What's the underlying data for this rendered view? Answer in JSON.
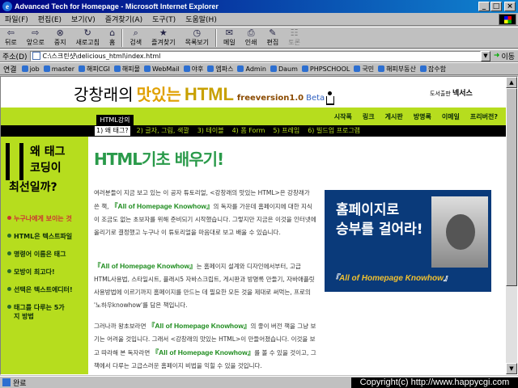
{
  "window": {
    "title": "Advanced Tech for Homepage - Microsoft Internet Explorer",
    "app_icon_glyph": "e",
    "controls": {
      "minimize": "_",
      "maximize": "□",
      "close": "×"
    }
  },
  "menu": [
    "파일(F)",
    "편집(E)",
    "보기(V)",
    "즐겨찾기(A)",
    "도구(T)",
    "도움말(H)"
  ],
  "toolbar": [
    {
      "label": "뒤로",
      "icon": "back-icon",
      "glyph": "⇦",
      "enabled": true
    },
    {
      "label": "앞으로",
      "icon": "forward-icon",
      "glyph": "⇨",
      "enabled": true
    },
    {
      "label": "중지",
      "icon": "stop-icon",
      "glyph": "⊗",
      "enabled": true
    },
    {
      "label": "새로고침",
      "icon": "refresh-icon",
      "glyph": "↻",
      "enabled": true
    },
    {
      "label": "홈",
      "icon": "home-icon",
      "glyph": "⌂",
      "enabled": true
    },
    {
      "label": "검색",
      "icon": "search-icon",
      "glyph": "⌕",
      "enabled": true
    },
    {
      "label": "즐겨찾기",
      "icon": "favorites-icon",
      "glyph": "★",
      "enabled": true
    },
    {
      "label": "목록보기",
      "icon": "history-icon",
      "glyph": "◷",
      "enabled": true
    },
    {
      "label": "메일",
      "icon": "mail-icon",
      "glyph": "✉",
      "enabled": true
    },
    {
      "label": "인쇄",
      "icon": "print-icon",
      "glyph": "⎙",
      "enabled": true
    },
    {
      "label": "편집",
      "icon": "edit-icon",
      "glyph": "✎",
      "enabled": true
    },
    {
      "label": "토론",
      "icon": "discuss-icon",
      "glyph": "☷",
      "enabled": false
    }
  ],
  "address": {
    "label": "주소(D)",
    "value": "C:\\스크린샷\\delicious_html\\index.html",
    "go_label": "이동",
    "go_glyph": "➜",
    "dropdown_glyph": "▼"
  },
  "links": {
    "label": "연결",
    "items": [
      "job",
      "master",
      "해피CGI",
      "해피몰",
      "WebMail",
      "야후",
      "엠파스",
      "Admin",
      "Daum",
      "PHPSCHOOL",
      "국민",
      "해피부동산",
      "잡수함"
    ]
  },
  "page": {
    "title_parts": [
      "강창래의",
      "맛있는",
      "HTML",
      "freeversion1.0",
      "Beta"
    ],
    "publisher_small": "도서출판",
    "publisher_name": "넥서스",
    "nav": [
      "시작폭",
      "링크",
      "게시판",
      "방명록",
      "이메일",
      "프리버전?"
    ],
    "tab_label": "HTML강의",
    "tabs": [
      "1) 왜 태그?",
      "2) 글자, 그림, 색깔",
      "3) 테이블",
      "4) 폼 Form",
      "5) 프레임",
      "6) 빌드업 프로그램"
    ],
    "sidebar_head": [
      "왜 태그",
      "코딩이",
      "최선일까?"
    ],
    "sidebar_items": [
      {
        "label": "누구나에게 보이는 것",
        "highlight": true
      },
      {
        "label": "HTML은 텍스트파일",
        "highlight": false
      },
      {
        "label": "명령어 이름은 태그",
        "highlight": false
      },
      {
        "label": "모방이 최고다!",
        "highlight": false
      },
      {
        "label": "선택은 텍스트에디터!",
        "highlight": false
      },
      {
        "label": "태그를 다루는 5가지 방법",
        "highlight": false
      }
    ],
    "main_title": "HTML기초 배우기!",
    "para1_a": "여러분들이 지금 보고 있는 이 공자 튜토리얼, <강창래의 맛있는 HTML>은 강창래가 쓴 책, ",
    "para1_hl": "『All of Homepage Knowhow』",
    "para1_b": "의 독자를 가운데 홈페이지에 대한 지식이 조금도 없는 초보자를 위해 준비되기 시작했습니다. 그렇지만 지금은 이것을 인터넷에 올리기로 결정했고 누구나 이 튜토리얼을 마음대로 보고 배울 수 있습니다.",
    "para2_hl": "『All of Homepage Knowhow』",
    "para2_b": "는 홈페이지 설계와 디자인에서부터, 고급 HTML사용법, 스타일시트, 플래시5 자바스크립트, 게시판과 방명록 만들기, 자바애플릿 사용방법에 이르기까지 홈페이지를 만드는 데 필요한 모든 것을 제대로 써먹는, 프로의 '노하우knowhow'를 담은 책입니다.",
    "para3_a": "그러나까 왕초보라면 ",
    "para3_hl1": "『All of Homepage Knowhow』",
    "para3_b": "의 좋이 버전 책을 그냥 보기는 어려울 것입니다. 그래서 <강창래의 맛있는 HTML>이 만들어졌습니다. 이것을 보고 따라해 본 독자라면 ",
    "para3_hl2": "『All of Homepage Knowhow』",
    "para3_c": "를 볼 수 있을 것이고, 그 책에서 다루는 고급스러운 홈페이지 비법을 익힐 수 있을 것입니다.",
    "book_ad": {
      "line1": "홈페이지로",
      "line2": "승부를 걸어라!",
      "line3_prefix": "『",
      "line3": "All of Homepage Knowhow",
      "line3_suffix": "』"
    }
  },
  "scrollbar": {
    "up_glyph": "▲",
    "down_glyph": "▼"
  },
  "status": {
    "text": "완료"
  },
  "copyright": "Copyright(c) http://www.happycgi.com"
}
